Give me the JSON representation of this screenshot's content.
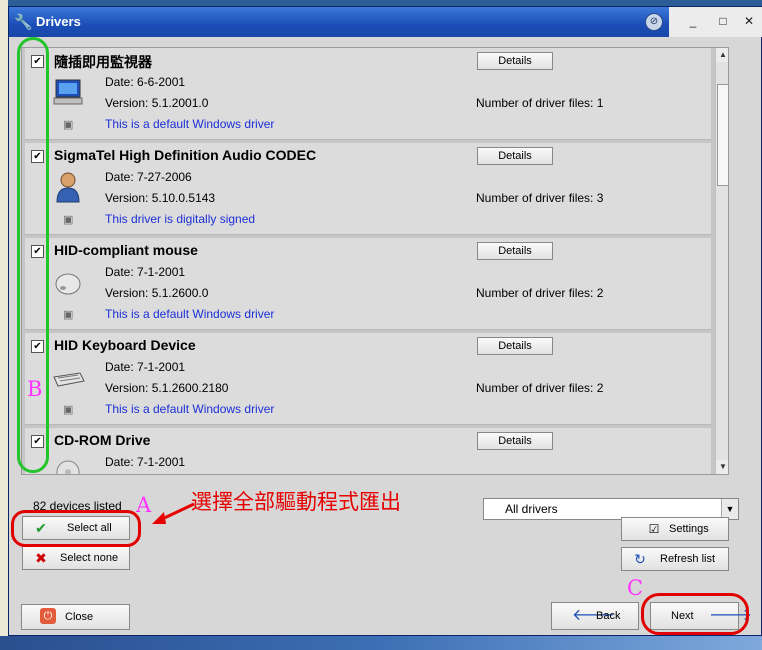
{
  "window": {
    "title": "Drivers",
    "icon": "wrench-icon",
    "controls": [
      "_",
      "□",
      "✕"
    ]
  },
  "drivers": [
    {
      "name": "隨插即用監視器",
      "date": "Date: 6-6-2001",
      "version": "Version: 5.1.2001.0",
      "signature": "This is a default Windows driver",
      "files": "Number of driver files: 1",
      "details_label": "Details",
      "icon": "monitor-icon",
      "checked": true
    },
    {
      "name": "SigmaTel High Definition Audio CODEC",
      "date": "Date: 7-27-2006",
      "version": "Version: 5.10.0.5143",
      "signature": "This driver is digitally signed",
      "files": "Number of driver files: 3",
      "details_label": "Details",
      "icon": "user-icon",
      "checked": true
    },
    {
      "name": "HID-compliant mouse",
      "date": "Date: 7-1-2001",
      "version": "Version: 5.1.2600.0",
      "signature": "This is a default Windows driver",
      "files": "Number of driver files: 2",
      "details_label": "Details",
      "icon": "mouse-icon",
      "checked": true
    },
    {
      "name": "HID Keyboard Device",
      "date": "Date: 7-1-2001",
      "version": "Version: 5.1.2600.2180",
      "signature": "This is a default Windows driver",
      "files": "Number of driver files: 2",
      "details_label": "Details",
      "icon": "keyboard-icon",
      "checked": true
    },
    {
      "name": "CD-ROM Drive",
      "date": "Date: 7-1-2001",
      "version": "",
      "signature": "",
      "files": "",
      "details_label": "Details",
      "icon": "cd-icon",
      "checked": true
    }
  ],
  "footer": {
    "count": "82 devices listed",
    "select_all": "Select all",
    "select_none": "Select none",
    "filter_value": "All drivers",
    "settings": "Settings",
    "refresh": "Refresh list",
    "close": "Close",
    "back": "Back",
    "next": "Next"
  },
  "annotations": {
    "a": "A",
    "b": "B",
    "c": "C",
    "instruction": "選擇全部驅動程式匯出",
    "highlight_color": "#e00000",
    "label_color": "#ff33ff",
    "checkbox_ring_color": "#22c52b"
  }
}
